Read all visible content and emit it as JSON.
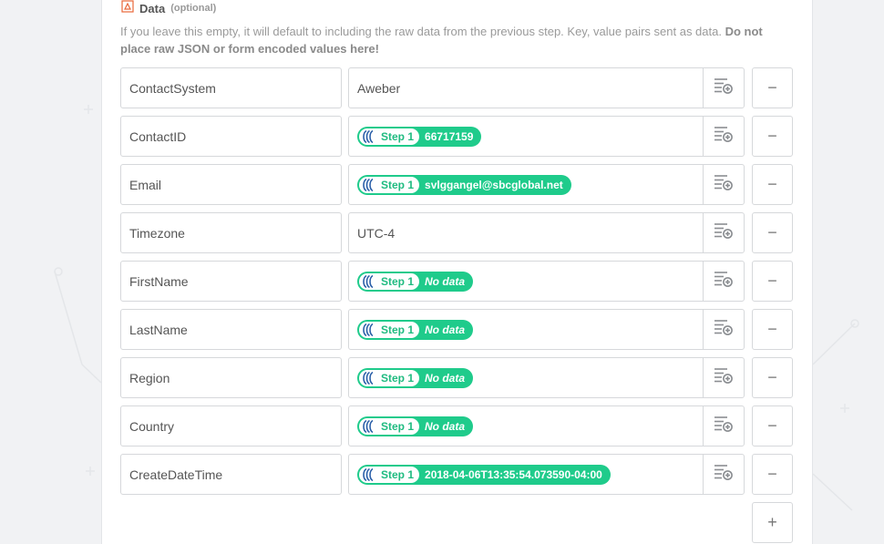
{
  "section": {
    "title": "Data",
    "optional": "(optional)",
    "help_text": "If you leave this empty, it will default to including the raw data from the previous step. Key, value pairs sent as data.",
    "help_bold": "Do not place raw JSON or form encoded values here!"
  },
  "rows": [
    {
      "key": "ContactSystem",
      "type": "text",
      "value": "Aweber"
    },
    {
      "key": "ContactID",
      "type": "pill",
      "step": "Step 1",
      "value": "66717159",
      "empty": false
    },
    {
      "key": "Email",
      "type": "pill",
      "step": "Step 1",
      "value": "svlggangel@sbcglobal.net",
      "empty": false
    },
    {
      "key": "Timezone",
      "type": "text",
      "value": "UTC-4"
    },
    {
      "key": "FirstName",
      "type": "pill",
      "step": "Step 1",
      "value": "No data",
      "empty": true
    },
    {
      "key": "LastName",
      "type": "pill",
      "step": "Step 1",
      "value": "No data",
      "empty": true
    },
    {
      "key": "Region",
      "type": "pill",
      "step": "Step 1",
      "value": "No data",
      "empty": true
    },
    {
      "key": "Country",
      "type": "pill",
      "step": "Step 1",
      "value": "No data",
      "empty": true
    },
    {
      "key": "CreateDateTime",
      "type": "pill",
      "step": "Step 1",
      "value": "2018-04-06T13:35:54.073590-04:00",
      "empty": false
    }
  ],
  "controls": {
    "remove_label": "−",
    "add_label": "+"
  },
  "icons": {
    "insert_field": "insert-field-icon",
    "step_app": "aweber-logo-icon",
    "data_section": "webhook-icon"
  },
  "colors": {
    "pill": "#1fcb8b",
    "step_text": "#1fbb80",
    "logo": "#2a5fa8",
    "border": "#d6d8db"
  }
}
